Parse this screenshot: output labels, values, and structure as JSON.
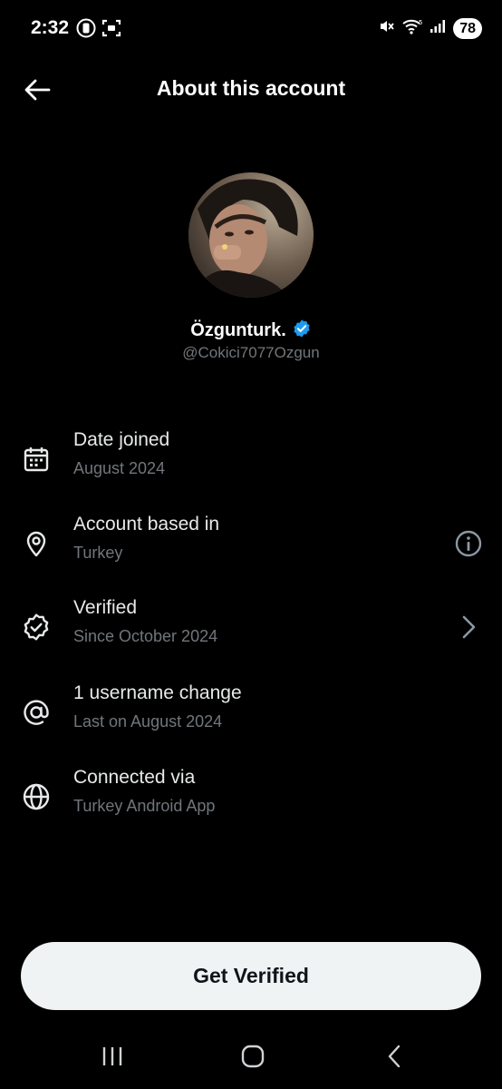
{
  "status_bar": {
    "time": "2:32",
    "battery": "78"
  },
  "header": {
    "title": "About this account"
  },
  "profile": {
    "display_name": "Özgunturk.",
    "handle": "@Cokici7077Ozgun"
  },
  "info_items": [
    {
      "title": "Date joined",
      "subtitle": "August 2024",
      "icon": "calendar-icon"
    },
    {
      "title": "Account based in",
      "subtitle": "Turkey",
      "icon": "location-pin-icon",
      "action_icon": "info-icon"
    },
    {
      "title": "Verified",
      "subtitle": "Since October 2024",
      "icon": "verified-badge-outline-icon",
      "action_icon": "chevron-right-icon"
    },
    {
      "title": "1 username change",
      "subtitle": "Last on August 2024",
      "icon": "at-sign-icon"
    },
    {
      "title": "Connected via",
      "subtitle": "Turkey Android App",
      "icon": "globe-icon"
    }
  ],
  "cta": {
    "label": "Get Verified"
  },
  "colors": {
    "background": "#000000",
    "primary_text": "#e7e9ea",
    "secondary_text": "#71767b",
    "verified_blue": "#1d9bf0",
    "button_bg": "#eff3f4"
  }
}
